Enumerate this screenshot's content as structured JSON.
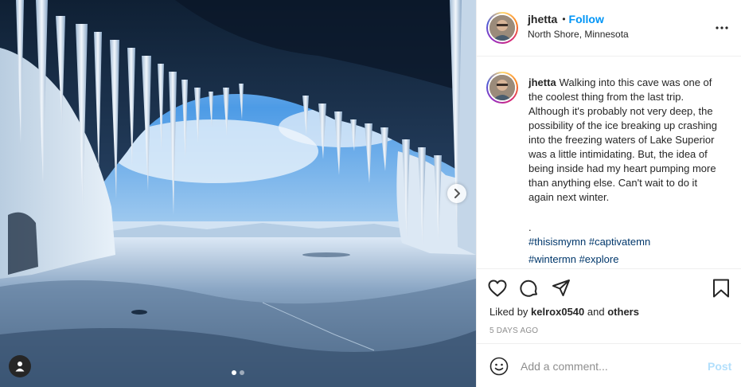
{
  "post": {
    "author": {
      "username": "jhetta",
      "location": "North Shore, Minnesota",
      "avatar_icon": "user-portrait-avatar"
    },
    "follow_label": "Follow",
    "bullet": "•",
    "more_icon": "ellipsis-icon",
    "caption": {
      "username": "jhetta",
      "text": "Walking into this cave was one of the coolest thing from the last trip. Although it's probably not very deep, the possibility of the ice breaking up crashing into the freezing waters of Lake Superior was a little intimidating. But, the idea of being inside had my heart pumping more than anything else. Can't wait to do it again next winter.",
      "dot": ".",
      "hashtags": "#thisismymn #captivatemn",
      "hashtags_partial": "#wintermn #explore"
    },
    "actions": {
      "like_icon": "heart-icon",
      "comment_icon": "comment-icon",
      "share_icon": "paper-plane-icon",
      "save_icon": "bookmark-icon"
    },
    "likes": {
      "prefix": "Liked by",
      "user": "kelrox0540",
      "and": "and",
      "others": "others"
    },
    "timestamp": "5 DAYS AGO",
    "add_comment": {
      "placeholder": "Add a comment...",
      "post_label": "Post",
      "emoji_icon": "smiley-icon"
    },
    "carousel": {
      "current": 1,
      "total": 2,
      "next_icon": "chevron-right-icon",
      "tag_icon": "user-tag-icon"
    },
    "colors": {
      "link": "#0095f6",
      "hashtag": "#00376b",
      "post_disabled": "#b2dffc",
      "muted": "#8e8e8e"
    }
  }
}
